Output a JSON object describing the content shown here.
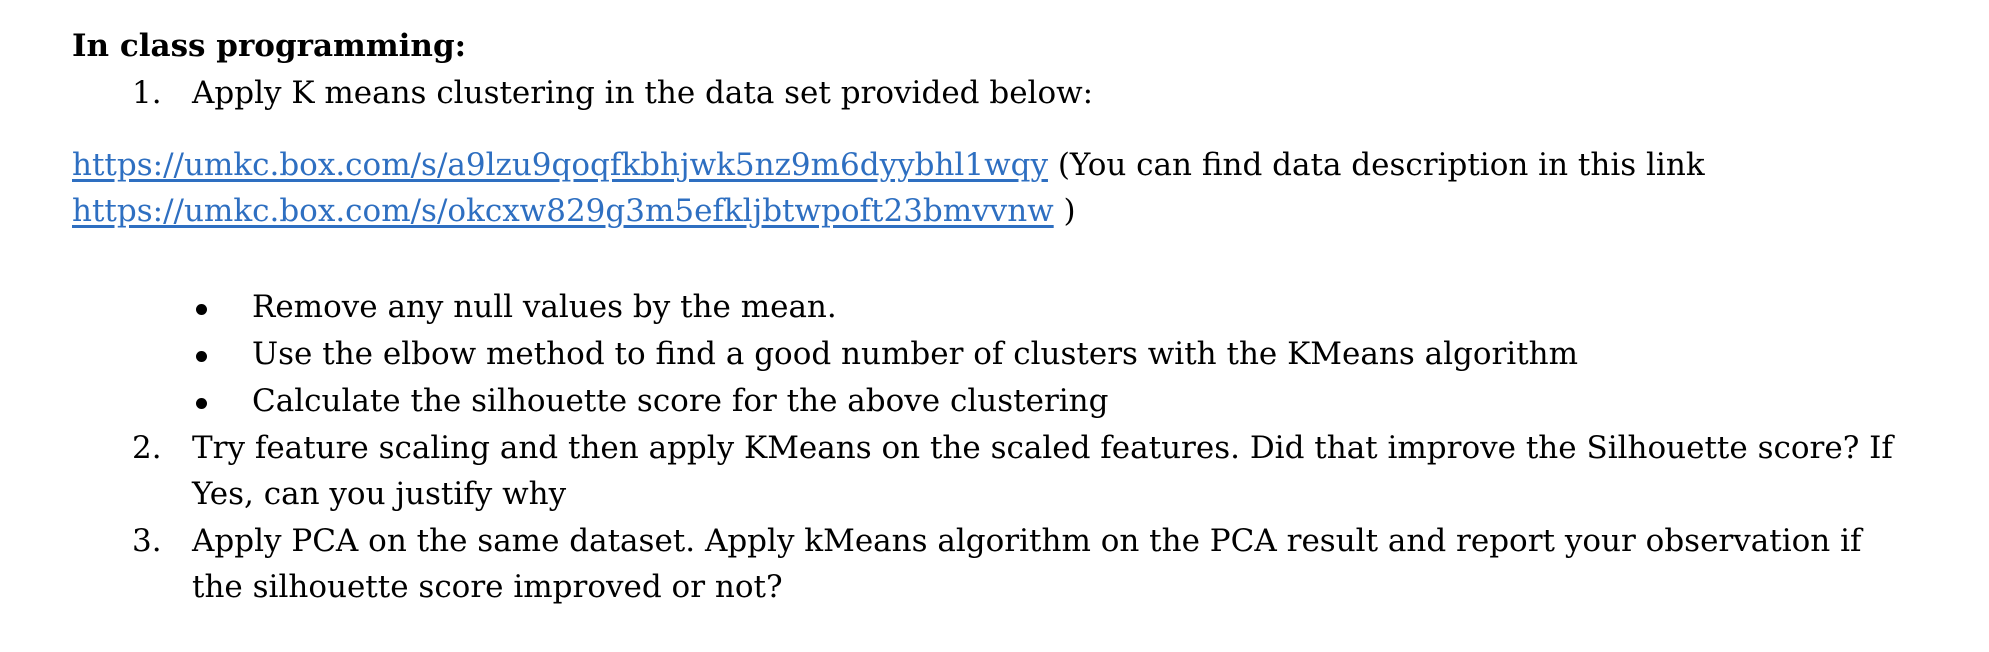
{
  "heading": "In class programming:",
  "items": [
    {
      "number": "1.",
      "text": "Apply K means clustering in the data set provided below:"
    },
    {
      "number": "2.",
      "line1": "Try feature scaling and then apply KMeans on the scaled features. Did that improve the Silhouette score? If",
      "line2": "Yes, can you justify why"
    },
    {
      "number": "3.",
      "line1": "Apply PCA on the same dataset. Apply kMeans algorithm on the PCA result and report your observation if",
      "line2": "the silhouette score improved or not?"
    }
  ],
  "links": {
    "data_link": "https://umkc.box.com/s/a9lzu9qoqfkbhjwk5nz9m6dyybhl1wqy",
    "description_prefix": " (You can find data description in this link",
    "description_link": "https://umkc.box.com/s/okcxw829g3m5efkljbtwpoft23bmvvnw",
    "description_suffix": " )"
  },
  "bullets": [
    "Remove any null values by the mean.",
    "Use the elbow method to find a good number of clusters with the KMeans algorithm",
    "Calculate the silhouette score for the above clustering"
  ],
  "colors": {
    "link": "#2e6fc1",
    "text": "#000000"
  }
}
